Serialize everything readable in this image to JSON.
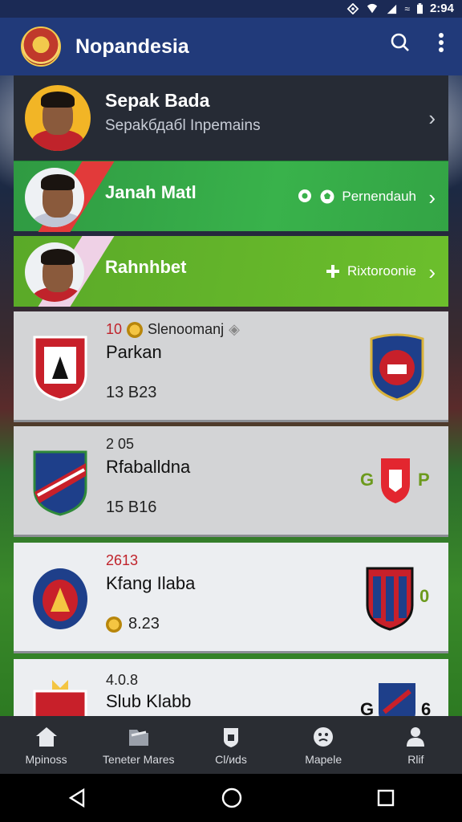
{
  "status_bar": {
    "time": "2:94",
    "icons": [
      "location-icon",
      "wifi-icon",
      "signal-icon",
      "sim-icon",
      "battery-icon"
    ]
  },
  "app_bar": {
    "title": "Nopandesia",
    "actions": [
      "search-icon",
      "more-vert-icon"
    ]
  },
  "featured": {
    "name": "Sepak Bada",
    "subtitle": "Sepakбдабl Inpemains"
  },
  "players": [
    {
      "name": "Janah Matl",
      "tag": "Pernendauh",
      "tag_icons": [
        "pin-icon",
        "ball-icon"
      ]
    },
    {
      "name": "Rahnhbet",
      "tag": "Rixtoroonie",
      "tag_icons": [
        "plus-icon"
      ]
    }
  ],
  "matches": [
    {
      "number": "10",
      "label": "Slenoomanj",
      "team": "Parkan",
      "score": "13 B23"
    },
    {
      "number": "2 05",
      "label": "",
      "team": "Rfaballdna",
      "score": "15 B16",
      "side_left": "G",
      "side_right": "P"
    },
    {
      "number": "2613",
      "label": "",
      "team": "Kfang Ilaba",
      "score": "8.23",
      "side_right": "0"
    },
    {
      "number": "4.0.8",
      "label": "",
      "team": "Slub Klabb",
      "score": "",
      "side_left": "G",
      "side_right": "6"
    }
  ],
  "bottom_nav": [
    {
      "label": "Mpinoss",
      "icon": "home-icon"
    },
    {
      "label": "Tenetеr Mares",
      "icon": "folder-icon"
    },
    {
      "label": "Cl/иds",
      "icon": "shield-lock-icon"
    },
    {
      "label": "Mapele",
      "icon": "face-icon"
    },
    {
      "label": "Rlif",
      "icon": "person-icon"
    }
  ],
  "colors": {
    "app_bar": "#213a7a",
    "green": "#39b24b",
    "lime": "#6cbf2c",
    "accent_red": "#c0232b"
  }
}
